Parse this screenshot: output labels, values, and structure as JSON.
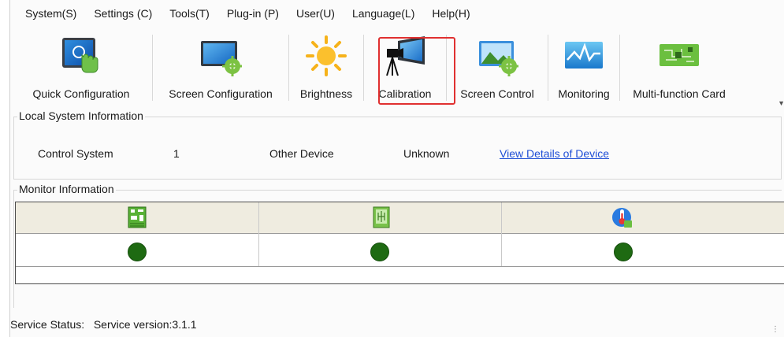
{
  "menu": [
    {
      "label": "System(S)"
    },
    {
      "label": "Settings (C)"
    },
    {
      "label": "Tools(T)"
    },
    {
      "label": "Plug-in (P)"
    },
    {
      "label": "User(U)"
    },
    {
      "label": "Language(L)"
    },
    {
      "label": "Help(H)"
    }
  ],
  "toolbar": {
    "items": [
      {
        "label": "Quick Configuration",
        "icon": "touch-screen-icon"
      },
      {
        "label": "Screen Configuration",
        "icon": "monitor-gear-icon"
      },
      {
        "label": "Brightness",
        "icon": "sun-icon"
      },
      {
        "label": "Calibration",
        "icon": "camera-screen-icon",
        "highlighted": true
      },
      {
        "label": "Screen Control",
        "icon": "image-gear-icon"
      },
      {
        "label": "Monitoring",
        "icon": "waveform-icon"
      },
      {
        "label": "Multi-function Card",
        "icon": "circuit-board-icon"
      }
    ],
    "highlight_color": "#e03030"
  },
  "local_system": {
    "title": "Local System Information",
    "control_system_label": "Control System",
    "control_system_value": "1",
    "other_device_label": "Other Device",
    "other_device_value": "Unknown",
    "details_link": "View Details of Device"
  },
  "monitor": {
    "title": "Monitor Information",
    "columns": [
      {
        "icon": "receiving-card-icon",
        "status_color": "#1e6a12"
      },
      {
        "icon": "function-card-icon",
        "status_color": "#1e6a12"
      },
      {
        "icon": "temperature-icon",
        "status_color": "#1e6a12"
      }
    ]
  },
  "status_bar": {
    "label": "Service Status:",
    "value": "Service version:3.1.1"
  }
}
